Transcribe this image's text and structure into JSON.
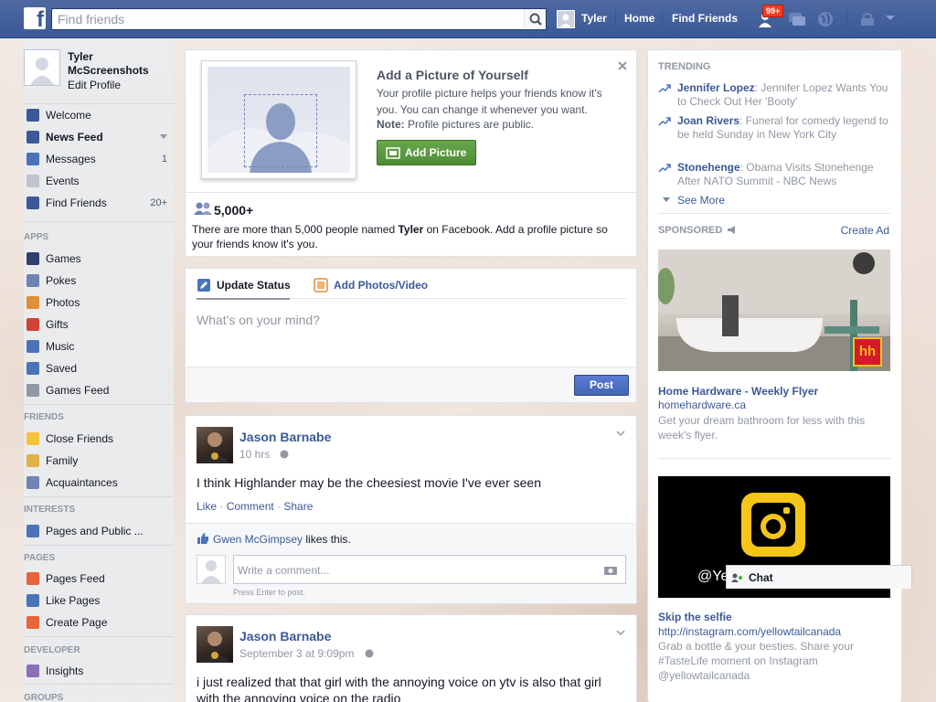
{
  "topbar": {
    "logo": "f",
    "search_placeholder": "Find friends",
    "user_name": "Tyler",
    "home": "Home",
    "find_friends": "Find Friends",
    "notif_count": "99+"
  },
  "left": {
    "name": "Tyler McScreenshots",
    "edit_profile": "Edit Profile",
    "main_items": [
      {
        "label": "Welcome",
        "count": "",
        "icon": "welcome-icon",
        "color": "#3b5998"
      },
      {
        "label": "News Feed",
        "count": "",
        "icon": "news-feed-icon",
        "color": "#3b5998"
      },
      {
        "label": "Messages",
        "count": "1",
        "icon": "messages-icon",
        "color": "#4a73b8"
      },
      {
        "label": "Events",
        "count": "",
        "icon": "events-icon",
        "color": "#c0c4cc"
      },
      {
        "label": "Find Friends",
        "count": "20+",
        "icon": "find-friends-icon",
        "color": "#3b5998"
      }
    ],
    "apps_header": "APPS",
    "apps": [
      {
        "label": "Games",
        "icon": "games-icon",
        "color": "#2f3f6f"
      },
      {
        "label": "Pokes",
        "icon": "pokes-icon",
        "color": "#6d84b4"
      },
      {
        "label": "Photos",
        "icon": "photos-icon",
        "color": "#e08e3a"
      },
      {
        "label": "Gifts",
        "icon": "gifts-icon",
        "color": "#d04437"
      },
      {
        "label": "Music",
        "icon": "music-icon",
        "color": "#4a73b8"
      },
      {
        "label": "Saved",
        "icon": "saved-icon",
        "color": "#4a73b8"
      },
      {
        "label": "Games Feed",
        "icon": "games-feed-icon",
        "color": "#9197a3"
      }
    ],
    "friends_header": "FRIENDS",
    "friends": [
      {
        "label": "Close Friends",
        "icon": "close-friends-icon",
        "color": "#f5c33b"
      },
      {
        "label": "Family",
        "icon": "family-icon",
        "color": "#e0b347"
      },
      {
        "label": "Acquaintances",
        "icon": "acquaintances-icon",
        "color": "#6d84b4"
      }
    ],
    "interests_header": "INTERESTS",
    "interests": [
      {
        "label": "Pages and Public ...",
        "icon": "pages-public-icon",
        "color": "#4a73b8"
      }
    ],
    "pages_header": "PAGES",
    "pages": [
      {
        "label": "Pages Feed",
        "icon": "pages-feed-icon",
        "color": "#e8643a"
      },
      {
        "label": "Like Pages",
        "icon": "like-pages-icon",
        "color": "#4a73b8"
      },
      {
        "label": "Create Page",
        "icon": "create-page-icon",
        "color": "#e8643a"
      }
    ],
    "developer_header": "DEVELOPER",
    "developer": [
      {
        "label": "Insights",
        "icon": "insights-icon",
        "color": "#8b6fb8"
      }
    ],
    "groups_header": "GROUPS"
  },
  "profile_prompt": {
    "title": "Add a Picture of Yourself",
    "desc": "Your profile picture helps your friends know it's you. You can change it whenever you want.",
    "note_label": "Note:",
    "note_text": "Profile pictures are public.",
    "button": "Add Picture",
    "count": "5,000+",
    "named_pre": "There are more than 5,000 people named ",
    "named_name": "Tyler",
    "named_post": " on Facebook. Add a profile picture so your friends know it's you."
  },
  "composer": {
    "tab_status": "Update Status",
    "tab_photos": "Add Photos/Video",
    "placeholder": "What's on your mind?",
    "post_button": "Post"
  },
  "posts": [
    {
      "author": "Jason Barnabe",
      "time": "10 hrs",
      "body": "I think Highlander may be the cheesiest movie I've ever seen",
      "actions": [
        "Like",
        "Comment",
        "Share"
      ],
      "liker": "Gwen McGimpsey",
      "likes_suffix": " likes this.",
      "comment_placeholder": "Write a comment...",
      "enter_hint": "Press Enter to post."
    },
    {
      "author": "Jason Barnabe",
      "time": "September 3 at 9:09pm",
      "body": "i just realized that that girl with the annoying voice on ytv is also that girl with the annoying voice on the radio"
    }
  ],
  "trending": {
    "header": "TRENDING",
    "items": [
      {
        "name": "Jennifer Lopez",
        "text": ": Jennifer Lopez Wants You to Check Out Her 'Booty'"
      },
      {
        "name": "Joan Rivers",
        "text": ": Funeral for comedy legend to be held Sunday in New York City"
      },
      {
        "name": "Stonehenge",
        "text": ": Obama Visits Stonehenge After NATO Summit - NBC News"
      }
    ],
    "see_more": "See More"
  },
  "sponsored": {
    "header": "SPONSORED",
    "create_ad": "Create Ad",
    "ads": [
      {
        "title": "Home Hardware - Weekly Flyer",
        "link": "homehardware.ca",
        "desc": "Get your dream bathroom for less with this week's flyer.",
        "logo_text": "hh"
      },
      {
        "title": "Skip the selfie",
        "link": "http://instagram.com/yellowtailcanada",
        "desc": "Grab a bottle & your besties. Share your #TasteLife moment on Instagram @yellowtailcanada",
        "image_text": "@Ye"
      }
    ]
  },
  "chat": {
    "label": "Chat"
  }
}
